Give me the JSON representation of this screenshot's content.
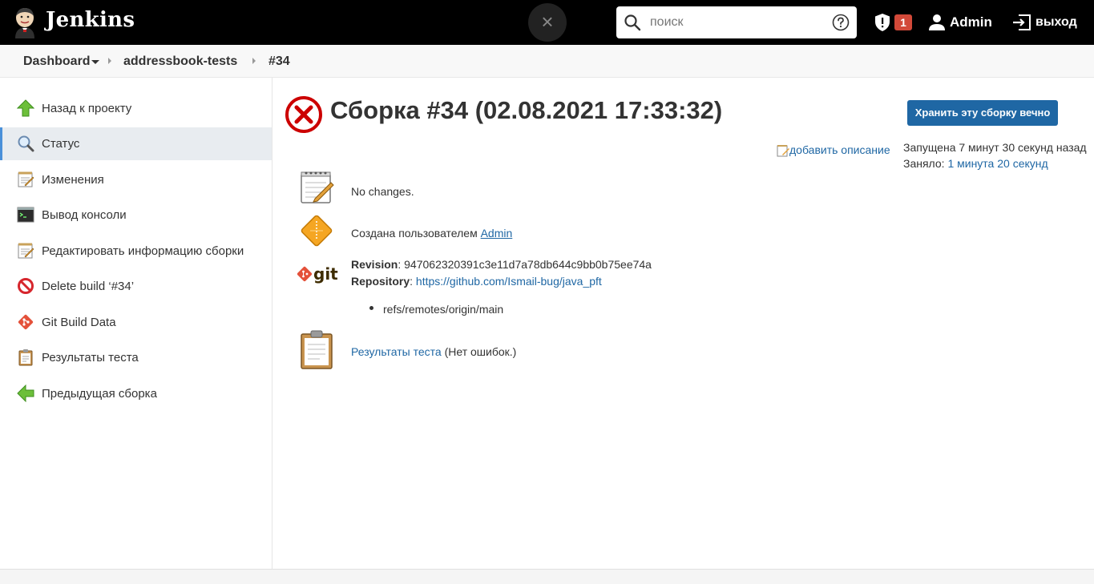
{
  "header": {
    "brand": "Jenkins",
    "close_symbol": "×",
    "search_placeholder": "поиск",
    "security_count": "1",
    "user_name": "Admin",
    "logout_label": "выход",
    "icons": [
      "jenkins-logo",
      "search-icon",
      "help-icon",
      "shield-icon",
      "user-icon",
      "logout-icon"
    ]
  },
  "breadcrumb": {
    "items": [
      "Dashboard",
      "addressbook-tests",
      "#34"
    ]
  },
  "sidebar": {
    "items": [
      {
        "label": "Назад к проекту",
        "icon": "up-arrow-icon"
      },
      {
        "label": "Статус",
        "icon": "magnifier-icon",
        "active": true
      },
      {
        "label": "Изменения",
        "icon": "notepad-icon"
      },
      {
        "label": "Вывод консоли",
        "icon": "terminal-icon"
      },
      {
        "label": "Редактировать информацию сборки",
        "icon": "notepad-icon"
      },
      {
        "label": "Delete build ‘#34’",
        "icon": "no-entry-icon"
      },
      {
        "label": "Git Build Data",
        "icon": "git-icon"
      },
      {
        "label": "Результаты теста",
        "icon": "clipboard-icon"
      },
      {
        "label": "Предыдущая сборка",
        "icon": "left-arrow-icon"
      }
    ]
  },
  "main": {
    "title": "Сборка #34 (02.08.2021 17:33:32)",
    "keep_button": "Хранить эту сборку вечно",
    "add_description": "добавить описание",
    "started": "Запущена 7 минут 30 секунд назад",
    "took_label": "Заняло: ",
    "took_value": "1 минута 20 секунд",
    "changes_text": "No changes.",
    "created_by_label": "Создана пользователем ",
    "created_by_user": "Admin",
    "revision_label": "Revision",
    "revision_value": ": 947062320391c3e11d7a78db644c9bb0b75ee74a",
    "repository_label": "Repository",
    "repository_sep": ": ",
    "repository_url": "https://github.com/Ismail-bug/java_pft",
    "branch": "refs/remotes/origin/main",
    "test_results_link": "Результаты теста",
    "test_results_note": " (Нет ошибок.)",
    "git_logo_text": "git"
  },
  "colors": {
    "header_bg": "#000000",
    "link": "#1f67a4",
    "button": "#1f67a4",
    "error_red": "#cc0000",
    "badge_red": "#d24939"
  }
}
